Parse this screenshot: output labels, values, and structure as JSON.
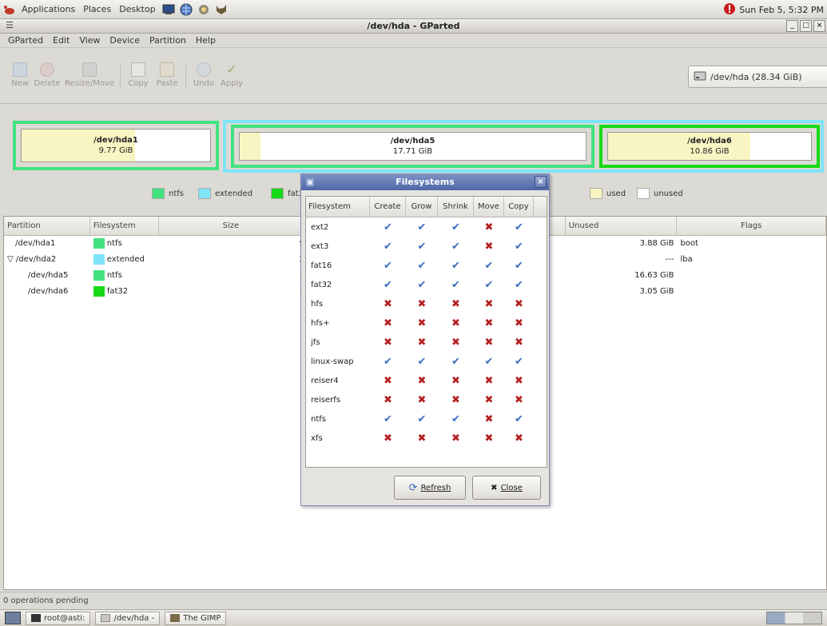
{
  "panel": {
    "menus": [
      "Applications",
      "Places",
      "Desktop"
    ],
    "clock": "Sun Feb 5, 5:32 PM"
  },
  "window": {
    "title": "/dev/hda - GParted",
    "menus": [
      "GParted",
      "Edit",
      "View",
      "Device",
      "Partition",
      "Help"
    ]
  },
  "toolbar": {
    "buttons": [
      "New",
      "Delete",
      "Resize/Move",
      "Copy",
      "Paste",
      "Undo",
      "Apply"
    ],
    "device": "/dev/hda  (28.34 GiB)"
  },
  "graphic": {
    "partitions": [
      {
        "name": "/dev/hda1",
        "size": "9.77 GiB",
        "used_fraction": 0.6
      },
      {
        "name": "/dev/hda5",
        "size": "17.71 GiB",
        "used_fraction": 0.06
      },
      {
        "name": "/dev/hda6",
        "size": "10.86 GiB",
        "used_fraction": 0.7
      }
    ],
    "colors": {
      "ntfs": "#42e27f",
      "extended": "#7fe4f6",
      "fat32": "#18d918",
      "used": "#f8f5c2",
      "unused": "#ffffff"
    }
  },
  "legend": {
    "ntfs": "ntfs",
    "extended": "extended",
    "fat32": "fat32",
    "used": "used",
    "unused": "unused"
  },
  "ptable": {
    "columns": [
      "Partition",
      "Filesystem",
      "Size",
      "Unused",
      "Flags"
    ],
    "rows": [
      {
        "partition": "/dev/hda1",
        "filesystem": "ntfs",
        "size": "9.77 GiB",
        "unused": "3.88 GiB",
        "flags": "boot",
        "color": "#42e27f"
      },
      {
        "partition": "/dev/hda2",
        "filesystem": "extended",
        "size": "28.57 GiB",
        "unused": "---",
        "flags": "lba",
        "color": "#7fe4f6"
      },
      {
        "partition": "/dev/hda5",
        "filesystem": "ntfs",
        "size": "17.71 GiB",
        "unused": "16.63 GiB",
        "flags": "",
        "color": "#42e27f"
      },
      {
        "partition": "/dev/hda6",
        "filesystem": "fat32",
        "size": "10.86 GiB",
        "unused": "3.05 GiB",
        "flags": "",
        "color": "#18d918"
      }
    ]
  },
  "status": "0 operations pending",
  "taskbar": {
    "tasks": [
      "root@asti:",
      "/dev/hda -",
      "The GIMP"
    ]
  },
  "dialog": {
    "title": "Filesystems",
    "columns": [
      "Filesystem",
      "Create",
      "Grow",
      "Shrink",
      "Move",
      "Copy"
    ],
    "rows": [
      {
        "fs": "ext2",
        "ops": [
          true,
          true,
          true,
          false,
          true
        ]
      },
      {
        "fs": "ext3",
        "ops": [
          true,
          true,
          true,
          false,
          true
        ]
      },
      {
        "fs": "fat16",
        "ops": [
          true,
          true,
          true,
          true,
          true
        ]
      },
      {
        "fs": "fat32",
        "ops": [
          true,
          true,
          true,
          true,
          true
        ]
      },
      {
        "fs": "hfs",
        "ops": [
          false,
          false,
          false,
          false,
          false
        ]
      },
      {
        "fs": "hfs+",
        "ops": [
          false,
          false,
          false,
          false,
          false
        ]
      },
      {
        "fs": "jfs",
        "ops": [
          false,
          false,
          false,
          false,
          false
        ]
      },
      {
        "fs": "linux-swap",
        "ops": [
          true,
          true,
          true,
          true,
          true
        ]
      },
      {
        "fs": "reiser4",
        "ops": [
          false,
          false,
          false,
          false,
          false
        ]
      },
      {
        "fs": "reiserfs",
        "ops": [
          false,
          false,
          false,
          false,
          false
        ]
      },
      {
        "fs": "ntfs",
        "ops": [
          true,
          true,
          true,
          false,
          true
        ]
      },
      {
        "fs": "xfs",
        "ops": [
          false,
          false,
          false,
          false,
          false
        ]
      }
    ],
    "refresh_label": "Refresh",
    "close_label": "Close"
  }
}
